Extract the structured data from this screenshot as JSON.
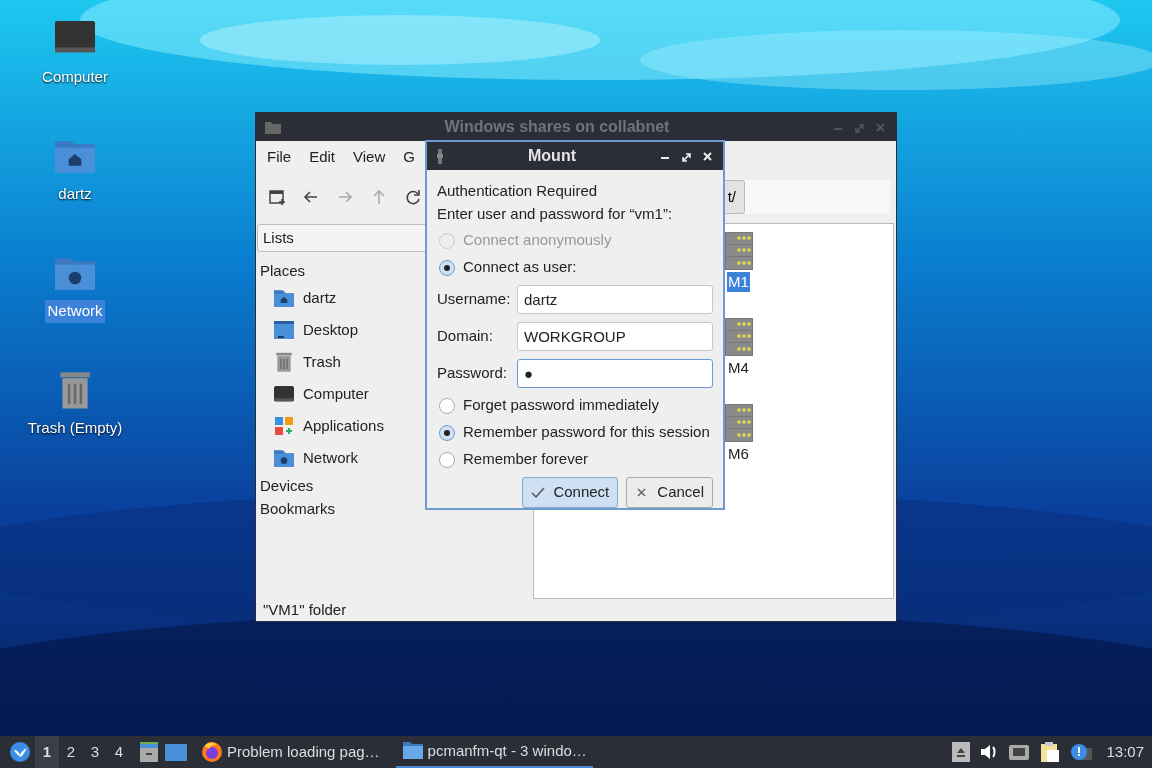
{
  "desktop_icons": [
    {
      "label": "Computer",
      "kind": "computer",
      "selected": false
    },
    {
      "label": "dartz",
      "kind": "home",
      "selected": false
    },
    {
      "label": "Network",
      "kind": "network",
      "selected": true
    },
    {
      "label": "Trash (Empty)",
      "kind": "trash",
      "selected": false
    }
  ],
  "file_manager": {
    "title": "Windows shares on collabnet",
    "menu": [
      "File",
      "Edit",
      "View",
      "G"
    ],
    "toolbar": [
      {
        "kind": "new-tab",
        "disabled": false
      },
      {
        "kind": "back",
        "disabled": false
      },
      {
        "kind": "forward",
        "disabled": true
      },
      {
        "kind": "up",
        "disabled": true
      },
      {
        "kind": "reload",
        "disabled": false
      }
    ],
    "path_button": "t/",
    "side_pane": {
      "mode": "Lists",
      "sections": [
        {
          "label": "Places",
          "items": [
            {
              "label": "dartz",
              "kind": "home"
            },
            {
              "label": "Desktop",
              "kind": "desktop"
            },
            {
              "label": "Trash",
              "kind": "trash"
            },
            {
              "label": "Computer",
              "kind": "computer"
            },
            {
              "label": "Applications",
              "kind": "applications"
            },
            {
              "label": "Network",
              "kind": "network"
            }
          ]
        },
        {
          "label": "Devices"
        },
        {
          "label": "Bookmarks"
        }
      ]
    },
    "files": [
      {
        "label": "M1",
        "selected": true
      },
      {
        "label": "M4",
        "selected": false
      },
      {
        "label": "M6",
        "selected": false
      }
    ],
    "status_bar": "\"VM1\" folder"
  },
  "dialog": {
    "title": "Mount",
    "heading": "Authentication Required",
    "prompt": "Enter user and password for “vm1”:",
    "connect_options": [
      {
        "label": "Connect anonymously",
        "selected": false,
        "disabled": true
      },
      {
        "label": "Connect as user:",
        "selected": true,
        "disabled": false
      }
    ],
    "fields": [
      {
        "label": "Username:",
        "value": "dartz",
        "focused": false
      },
      {
        "label": "Domain:",
        "value": "WORKGROUP",
        "focused": false
      },
      {
        "label": "Password:",
        "value": "●",
        "focused": true
      }
    ],
    "remember_options": [
      {
        "label": "Forget password immediately",
        "selected": false
      },
      {
        "label": "Remember password for this session",
        "selected": true
      },
      {
        "label": "Remember forever",
        "selected": false
      }
    ],
    "buttons": [
      {
        "label": "Connect",
        "kind": "confirm"
      },
      {
        "label": "Cancel",
        "kind": "cancel"
      }
    ]
  },
  "taskbar": {
    "workspaces": [
      {
        "label": "1",
        "selected": true
      },
      {
        "label": "2",
        "selected": false
      },
      {
        "label": "3",
        "selected": false
      },
      {
        "label": "4",
        "selected": false
      }
    ],
    "tasks": [
      {
        "label": "Problem loading pag…",
        "kind": "browser",
        "selected": false
      },
      {
        "label": "pcmanfm-qt - 3 windo…",
        "kind": "folder",
        "selected": true
      }
    ],
    "clock": "13:07"
  }
}
